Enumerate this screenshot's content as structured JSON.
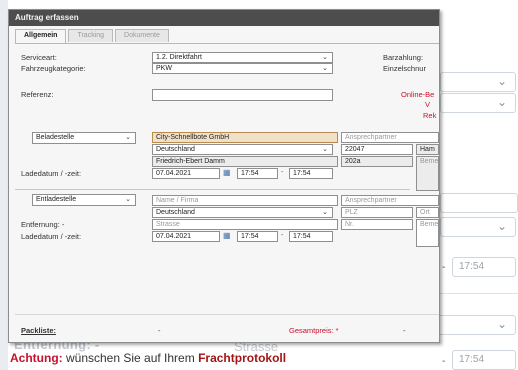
{
  "dialog": {
    "title": "Auftrag erfassen",
    "tabs": [
      {
        "label": "Allgemein",
        "active": true
      },
      {
        "label": "Tracking",
        "active": false
      },
      {
        "label": "Dokumente",
        "active": false
      }
    ]
  },
  "general": {
    "serviceart_label": "Serviceart:",
    "serviceart_value": "1.2. Direktfahrt",
    "fahrzeug_label": "Fahrzeugkategorie:",
    "fahrzeug_value": "PKW",
    "barzahlung_label": "Barzahlung:",
    "einzelschnur_label": "Einzelschnur",
    "referenz_label": "Referenz:",
    "referenz_value": "",
    "online_label": "Online-Be",
    "v_label": "V",
    "rek_label": "Rek"
  },
  "pickup": {
    "type_value": "Beladestelle",
    "firma_value": "City-Schnellbote GmbH",
    "contact_placeholder": "Ansprechpartner",
    "country_value": "Deutschland",
    "plz_value": "22047",
    "city_value": "Ham",
    "street_value": "Friedrich-Ebert Damm",
    "nr_value": "202a",
    "bem_value": "Beme",
    "date_label": "Ladedatum / -zeit:",
    "date_value": "07.04.2021",
    "time_from": "17:54",
    "time_to": "17:54"
  },
  "delivery": {
    "type_value": "Entladestelle",
    "firma_placeholder": "Name / Firma",
    "contact_placeholder": "Ansprechpartner",
    "country_value": "Deutschland",
    "plz_placeholder": "PLZ",
    "city_placeholder": "Ort",
    "street_placeholder": "Strasse",
    "nr_placeholder": "Nr.",
    "bem_value": "Beme",
    "distance_label": "Entfernung: -",
    "date_label": "Ladedatum / -zeit:",
    "date_value": "07.04.2021",
    "time_from": "17:54",
    "time_to": "17:54"
  },
  "footer": {
    "packliste_label": "Packliste:",
    "packliste_value": "-",
    "gesamtpreis_label": "Gesamtpreis: *",
    "gesamtpreis_value": "-"
  },
  "background": {
    "time_1": "17:54",
    "dash_1": "-",
    "entfernung_label": "Entfernung: -",
    "strasse_placeholder": "Strasse",
    "time_2": "17:54",
    "dash_2": "-"
  },
  "notice": {
    "prefix": "Achtung:",
    "text": " wünschen Sie auf Ihrem ",
    "highlight": "Frachtprotokoll"
  }
}
